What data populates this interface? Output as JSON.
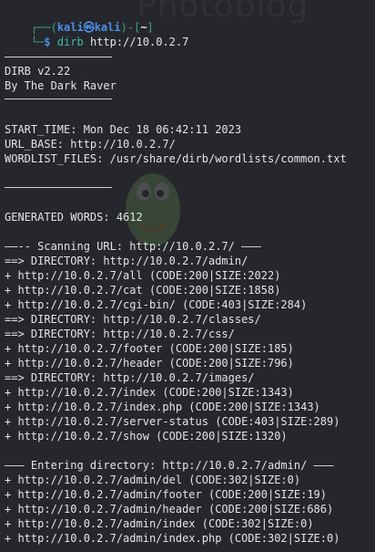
{
  "watermark": "Photoblog",
  "prompt": {
    "frame_top": "┌──(",
    "user": "kali㉿kali",
    "frame_mid": ")-[",
    "dir": "~",
    "frame_end": "]",
    "frame_bottom": "└─",
    "dollar": "$",
    "command": "dirb",
    "argument": "http://10.0.2.7"
  },
  "output": {
    "version": "DIRB v2.22",
    "author": "By The Dark Raver",
    "start_time": "START_TIME: Mon Dec 18 06:42:11 2023",
    "url_base": "URL_BASE: http://10.0.2.7/",
    "wordlist": "WORDLIST_FILES: /usr/share/dirb/wordlists/common.txt",
    "generated_words": "GENERATED WORDS: 4612",
    "scan_header": "——-- Scanning URL: http://10.0.2.7/ ———",
    "scan_lines": [
      "==> DIRECTORY: http://10.0.2.7/admin/",
      "+ http://10.0.2.7/all (CODE:200|SIZE:2022)",
      "+ http://10.0.2.7/cat (CODE:200|SIZE:1858)",
      "+ http://10.0.2.7/cgi-bin/ (CODE:403|SIZE:284)",
      "==> DIRECTORY: http://10.0.2.7/classes/",
      "==> DIRECTORY: http://10.0.2.7/css/",
      "+ http://10.0.2.7/footer (CODE:200|SIZE:185)",
      "+ http://10.0.2.7/header (CODE:200|SIZE:796)",
      "==> DIRECTORY: http://10.0.2.7/images/",
      "+ http://10.0.2.7/index (CODE:200|SIZE:1343)",
      "+ http://10.0.2.7/index.php (CODE:200|SIZE:1343)",
      "+ http://10.0.2.7/server-status (CODE:403|SIZE:289)",
      "+ http://10.0.2.7/show (CODE:200|SIZE:1320)"
    ],
    "enter_header": "——— Entering directory: http://10.0.2.7/admin/ ———",
    "enter_lines": [
      "+ http://10.0.2.7/admin/del (CODE:302|SIZE:0)",
      "+ http://10.0.2.7/admin/footer (CODE:200|SIZE:19)",
      "+ http://10.0.2.7/admin/header (CODE:200|SIZE:686)",
      "+ http://10.0.2.7/admin/index (CODE:302|SIZE:0)",
      "+ http://10.0.2.7/admin/index.php (CODE:302|SIZE:0)"
    ]
  }
}
